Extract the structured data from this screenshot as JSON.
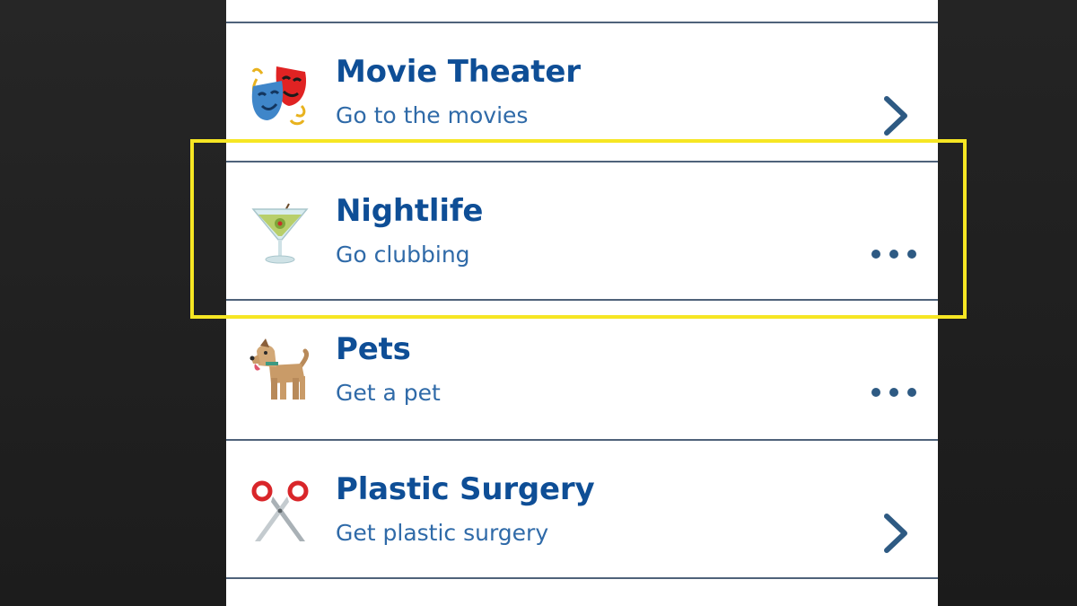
{
  "colors": {
    "title": "#0e4e96",
    "subtitle": "#2f6aa8",
    "divider": "#4f627a",
    "highlight": "#f6e623",
    "action": "#2e5a83"
  },
  "activities": [
    {
      "title": "Movie Theater",
      "subtitle": "Go to the movies",
      "icon": "theater-masks-icon",
      "action": "chevron-right-icon"
    },
    {
      "title": "Nightlife",
      "subtitle": "Go clubbing",
      "icon": "cocktail-glass-icon",
      "action": "more-dots-icon"
    },
    {
      "title": "Pets",
      "subtitle": "Get a pet",
      "icon": "dog-icon",
      "action": "more-dots-icon"
    },
    {
      "title": "Plastic Surgery",
      "subtitle": "Get plastic surgery",
      "icon": "scissors-icon",
      "action": "chevron-right-icon"
    }
  ]
}
